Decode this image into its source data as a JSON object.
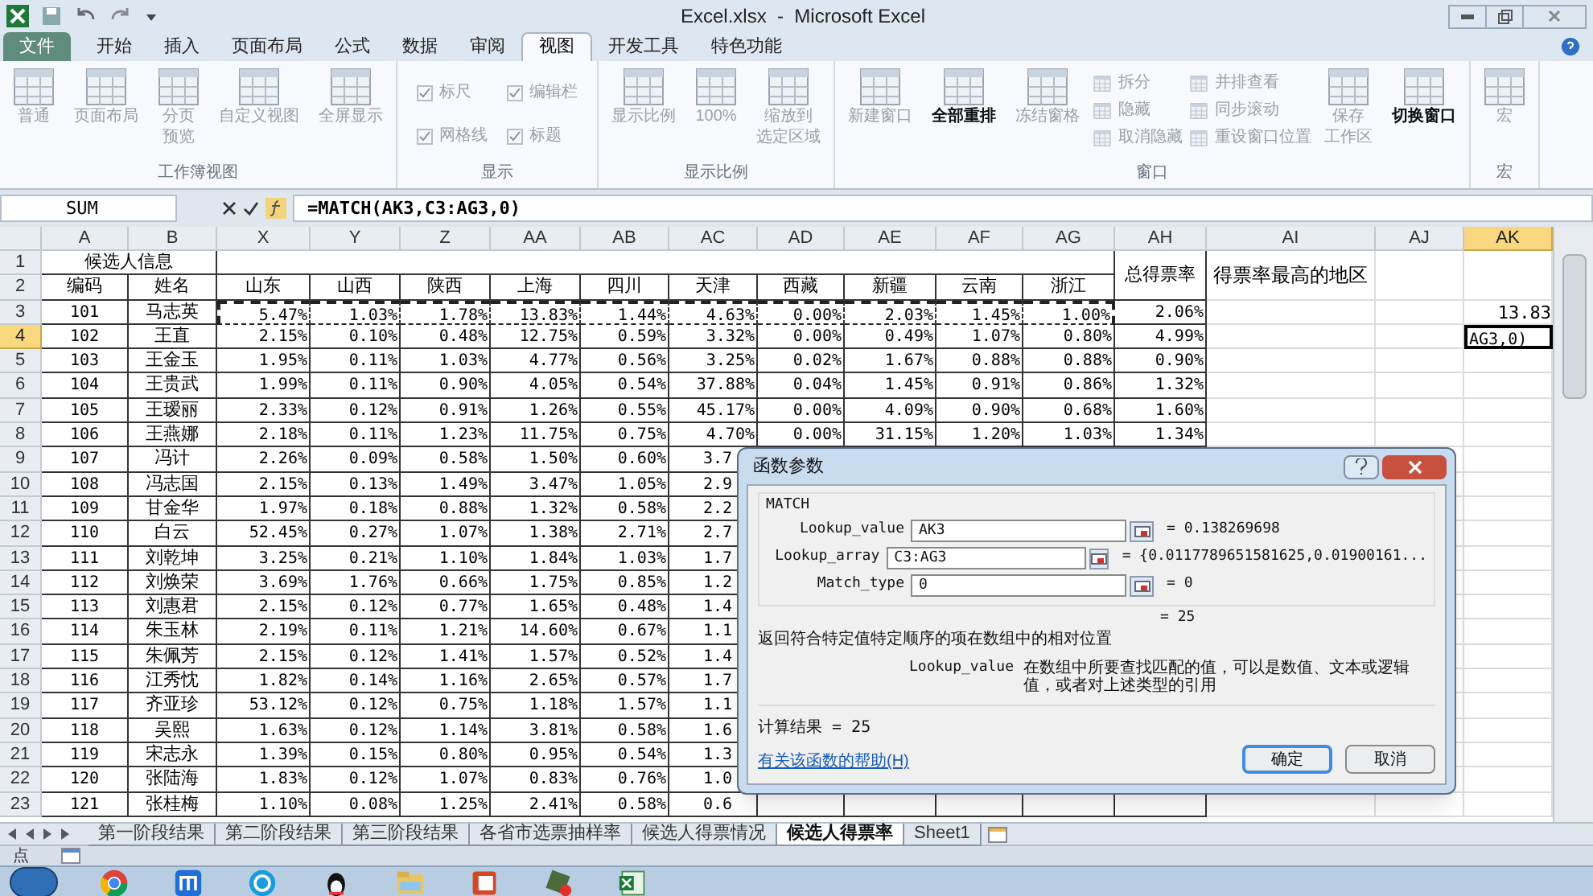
{
  "title_bar": {
    "title": "Excel.xlsx  -  Microsoft Excel"
  },
  "ribbon_tabs": [
    {
      "label": "文件",
      "kind": "file",
      "selected": false
    },
    {
      "label": "开始",
      "kind": "tab",
      "selected": false
    },
    {
      "label": "插入",
      "kind": "tab",
      "selected": false
    },
    {
      "label": "页面布局",
      "kind": "tab",
      "selected": false
    },
    {
      "label": "公式",
      "kind": "tab",
      "selected": false
    },
    {
      "label": "数据",
      "kind": "tab",
      "selected": false
    },
    {
      "label": "审阅",
      "kind": "tab",
      "selected": false
    },
    {
      "label": "视图",
      "kind": "tab",
      "selected": true
    },
    {
      "label": "开发工具",
      "kind": "tab",
      "selected": false
    },
    {
      "label": "特色功能",
      "kind": "tab",
      "selected": false
    }
  ],
  "ribbon_groups": [
    {
      "label": "工作簿视图",
      "items": [
        {
          "kind": "large",
          "lines": [
            "普通"
          ],
          "disabled": true
        },
        {
          "kind": "large",
          "lines": [
            "页面布局"
          ],
          "disabled": true
        },
        {
          "kind": "large",
          "lines": [
            "分页",
            "预览"
          ],
          "disabled": true
        },
        {
          "kind": "large",
          "lines": [
            "自定义视图"
          ],
          "disabled": true
        },
        {
          "kind": "large",
          "lines": [
            "全屏显示"
          ],
          "disabled": true
        }
      ]
    },
    {
      "label": "显示",
      "items": [
        {
          "kind": "check",
          "lines": [
            "标尺"
          ],
          "checked": true,
          "disabled": true
        },
        {
          "kind": "check",
          "lines": [
            "编辑栏"
          ],
          "checked": true,
          "disabled": true
        },
        {
          "kind": "check",
          "lines": [
            "网格线"
          ],
          "checked": true,
          "disabled": true
        },
        {
          "kind": "check",
          "lines": [
            "标题"
          ],
          "checked": true,
          "disabled": true
        }
      ]
    },
    {
      "label": "显示比例",
      "items": [
        {
          "kind": "large",
          "lines": [
            "显示比例"
          ],
          "disabled": true
        },
        {
          "kind": "large",
          "lines": [
            "100%"
          ],
          "disabled": true
        },
        {
          "kind": "large",
          "lines": [
            "缩放到",
            "选定区域"
          ],
          "disabled": true
        }
      ]
    },
    {
      "label": "窗口",
      "items": [
        {
          "kind": "large",
          "lines": [
            "新建窗口"
          ],
          "disabled": true
        },
        {
          "kind": "large",
          "lines": [
            "全部重排"
          ],
          "disabled": false
        },
        {
          "kind": "large",
          "lines": [
            "冻结窗格"
          ],
          "disabled": true
        },
        {
          "kind": "small",
          "lines": [
            "拆分"
          ],
          "disabled": true
        },
        {
          "kind": "small",
          "lines": [
            "隐藏"
          ],
          "disabled": true
        },
        {
          "kind": "small",
          "lines": [
            "取消隐藏"
          ],
          "disabled": true
        },
        {
          "kind": "small",
          "lines": [
            "并排查看"
          ],
          "disabled": true
        },
        {
          "kind": "small",
          "lines": [
            "同步滚动"
          ],
          "disabled": true
        },
        {
          "kind": "small",
          "lines": [
            "重设窗口位置"
          ],
          "disabled": true
        },
        {
          "kind": "large",
          "lines": [
            "保存",
            "工作区"
          ],
          "disabled": true
        },
        {
          "kind": "large",
          "lines": [
            "切换窗口"
          ],
          "disabled": false
        }
      ]
    },
    {
      "label": "宏",
      "items": [
        {
          "kind": "large",
          "lines": [
            "宏"
          ],
          "disabled": true
        }
      ]
    }
  ],
  "formula_bar": {
    "name_box": "SUM",
    "formula": "=MATCH(AK3,C3:AG3,0)"
  },
  "columns": [
    {
      "label": "A",
      "selected": false
    },
    {
      "label": "B",
      "selected": false
    },
    {
      "label": "X",
      "selected": false
    },
    {
      "label": "Y",
      "selected": false
    },
    {
      "label": "Z",
      "selected": false
    },
    {
      "label": "AA",
      "selected": false
    },
    {
      "label": "AB",
      "selected": false
    },
    {
      "label": "AC",
      "selected": false
    },
    {
      "label": "AD",
      "selected": false
    },
    {
      "label": "AE",
      "selected": false
    },
    {
      "label": "AF",
      "selected": false
    },
    {
      "label": "AG",
      "selected": false
    },
    {
      "label": "AH",
      "selected": false
    },
    {
      "label": "AI",
      "selected": false
    },
    {
      "label": "AJ",
      "selected": false
    },
    {
      "label": "AK",
      "selected": true
    }
  ],
  "header": {
    "row_numbers": [
      "1",
      "2"
    ],
    "group_title": "候选人信息",
    "id_label": "编码",
    "name_label": "姓名",
    "regions": [
      "山东",
      "山西",
      "陕西",
      "上海",
      "四川",
      "天津",
      "西藏",
      "新疆",
      "云南",
      "浙江"
    ],
    "total_label": "总得票率",
    "best_label": "得票率最高的地区"
  },
  "rows": [
    {
      "number": "3",
      "selected": false,
      "referenced": true,
      "under_dialog": false,
      "id": "101",
      "name": "马志英",
      "rates": [
        "5.47%",
        "1.03%",
        "1.78%",
        "13.83%",
        "1.44%",
        "4.63%",
        "0.00%",
        "2.03%",
        "1.45%",
        "1.00%"
      ],
      "total": "2.06%",
      "ak": "13.83"
    },
    {
      "number": "4",
      "selected": true,
      "referenced": false,
      "under_dialog": false,
      "id": "102",
      "name": "王直",
      "rates": [
        "2.15%",
        "0.10%",
        "0.48%",
        "12.75%",
        "0.59%",
        "3.32%",
        "0.00%",
        "0.49%",
        "1.07%",
        "0.80%"
      ],
      "total": "4.99%",
      "ak": "AG3,0)"
    },
    {
      "number": "5",
      "selected": false,
      "referenced": false,
      "under_dialog": false,
      "id": "103",
      "name": "王金玉",
      "rates": [
        "1.95%",
        "0.11%",
        "1.03%",
        "4.77%",
        "0.56%",
        "3.25%",
        "0.02%",
        "1.67%",
        "0.88%",
        "0.88%"
      ],
      "total": "0.90%"
    },
    {
      "number": "6",
      "selected": false,
      "referenced": false,
      "under_dialog": false,
      "id": "104",
      "name": "王贵武",
      "rates": [
        "1.99%",
        "0.11%",
        "0.90%",
        "4.05%",
        "0.54%",
        "37.88%",
        "0.04%",
        "1.45%",
        "0.91%",
        "0.86%"
      ],
      "total": "1.32%"
    },
    {
      "number": "7",
      "selected": false,
      "referenced": false,
      "under_dialog": false,
      "id": "105",
      "name": "王瑷丽",
      "rates": [
        "2.33%",
        "0.12%",
        "0.91%",
        "1.26%",
        "0.55%",
        "45.17%",
        "0.00%",
        "4.09%",
        "0.90%",
        "0.68%"
      ],
      "total": "1.60%"
    },
    {
      "number": "8",
      "selected": false,
      "referenced": false,
      "under_dialog": false,
      "id": "106",
      "name": "王燕娜",
      "rates": [
        "2.18%",
        "0.11%",
        "1.23%",
        "11.75%",
        "0.75%",
        "4.70%",
        "0.00%",
        "31.15%",
        "1.20%",
        "1.03%"
      ],
      "total": "1.34%"
    },
    {
      "number": "9",
      "selected": false,
      "referenced": false,
      "under_dialog": true,
      "id": "107",
      "name": "冯计",
      "rates": [
        "2.26%",
        "0.09%",
        "0.58%",
        "1.50%",
        "0.60%",
        "3.7"
      ]
    },
    {
      "number": "10",
      "selected": false,
      "referenced": false,
      "under_dialog": true,
      "id": "108",
      "name": "冯志国",
      "rates": [
        "2.15%",
        "0.13%",
        "1.49%",
        "3.47%",
        "1.05%",
        "2.9"
      ]
    },
    {
      "number": "11",
      "selected": false,
      "referenced": false,
      "under_dialog": true,
      "id": "109",
      "name": "甘金华",
      "rates": [
        "1.97%",
        "0.18%",
        "0.88%",
        "1.32%",
        "0.58%",
        "2.2"
      ]
    },
    {
      "number": "12",
      "selected": false,
      "referenced": false,
      "under_dialog": true,
      "id": "110",
      "name": "白云",
      "rates": [
        "52.45%",
        "0.27%",
        "1.07%",
        "1.38%",
        "2.71%",
        "2.7"
      ]
    },
    {
      "number": "13",
      "selected": false,
      "referenced": false,
      "under_dialog": true,
      "id": "111",
      "name": "刘乾坤",
      "rates": [
        "3.25%",
        "0.21%",
        "1.10%",
        "1.84%",
        "1.03%",
        "1.7"
      ]
    },
    {
      "number": "14",
      "selected": false,
      "referenced": false,
      "under_dialog": true,
      "id": "112",
      "name": "刘焕荣",
      "rates": [
        "3.69%",
        "1.76%",
        "0.66%",
        "1.75%",
        "0.85%",
        "1.2"
      ]
    },
    {
      "number": "15",
      "selected": false,
      "referenced": false,
      "under_dialog": true,
      "id": "113",
      "name": "刘惠君",
      "rates": [
        "2.15%",
        "0.12%",
        "0.77%",
        "1.65%",
        "0.48%",
        "1.4"
      ]
    },
    {
      "number": "16",
      "selected": false,
      "referenced": false,
      "under_dialog": true,
      "id": "114",
      "name": "朱玉林",
      "rates": [
        "2.19%",
        "0.11%",
        "1.21%",
        "14.60%",
        "0.67%",
        "1.1"
      ]
    },
    {
      "number": "17",
      "selected": false,
      "referenced": false,
      "under_dialog": true,
      "id": "115",
      "name": "朱佩芳",
      "rates": [
        "2.15%",
        "0.12%",
        "1.41%",
        "1.57%",
        "0.52%",
        "1.4"
      ]
    },
    {
      "number": "18",
      "selected": false,
      "referenced": false,
      "under_dialog": true,
      "id": "116",
      "name": "江秀忱",
      "rates": [
        "1.82%",
        "0.14%",
        "1.16%",
        "2.65%",
        "0.57%",
        "1.7"
      ]
    },
    {
      "number": "19",
      "selected": false,
      "referenced": false,
      "under_dialog": true,
      "id": "117",
      "name": "齐亚珍",
      "rates": [
        "53.12%",
        "0.12%",
        "0.75%",
        "1.18%",
        "1.57%",
        "1.1"
      ]
    },
    {
      "number": "20",
      "selected": false,
      "referenced": false,
      "under_dialog": true,
      "id": "118",
      "name": "吴熙",
      "rates": [
        "1.63%",
        "0.12%",
        "1.14%",
        "3.81%",
        "0.58%",
        "1.6"
      ]
    },
    {
      "number": "21",
      "selected": false,
      "referenced": false,
      "under_dialog": true,
      "id": "119",
      "name": "宋志永",
      "rates": [
        "1.39%",
        "0.15%",
        "0.80%",
        "0.95%",
        "0.54%",
        "1.3"
      ]
    },
    {
      "number": "22",
      "selected": false,
      "referenced": false,
      "under_dialog": true,
      "id": "120",
      "name": "张陆海",
      "rates": [
        "1.83%",
        "0.12%",
        "1.07%",
        "0.83%",
        "0.76%",
        "1.0"
      ]
    },
    {
      "number": "23",
      "selected": false,
      "referenced": false,
      "under_dialog": true,
      "id": "121",
      "name": "张桂梅",
      "rates": [
        "1.10%",
        "0.08%",
        "1.25%",
        "2.41%",
        "0.58%",
        "0.6"
      ]
    }
  ],
  "sheet_tabs": [
    {
      "label": "第一阶段结果",
      "selected": false
    },
    {
      "label": "第二阶段结果",
      "selected": false
    },
    {
      "label": "第三阶段结果",
      "selected": false
    },
    {
      "label": "各省市选票抽样率",
      "selected": false
    },
    {
      "label": "候选人得票情况",
      "selected": false
    },
    {
      "label": "候选人得票率",
      "selected": true
    },
    {
      "label": "Sheet1",
      "selected": false
    }
  ],
  "status_bar": {
    "mode": "点"
  },
  "dialog": {
    "title": "函数参数",
    "function": "MATCH",
    "args": [
      {
        "name": "Lookup_value",
        "value": "AK3",
        "result": "=  0.138269698"
      },
      {
        "name": "Lookup_array",
        "value": "C3:AG3",
        "result": "=  {0.0117789651581625,0.01900161..."
      },
      {
        "name": "Match_type",
        "value": "0",
        "result": "=  0"
      }
    ],
    "result": "=  25",
    "description": "返回符合特定值特定顺序的项在数组中的相对位置",
    "arg_help": {
      "name": "Lookup_value",
      "text": "在数组中所要查找匹配的值，可以是数值、文本或逻辑值，或者对上述类型的引用"
    },
    "calc_result": "计算结果 =  25",
    "help_link": "有关该函数的帮助(H)",
    "buttons": [
      {
        "label": "确定",
        "default": true
      },
      {
        "label": "取消",
        "default": false
      }
    ]
  }
}
